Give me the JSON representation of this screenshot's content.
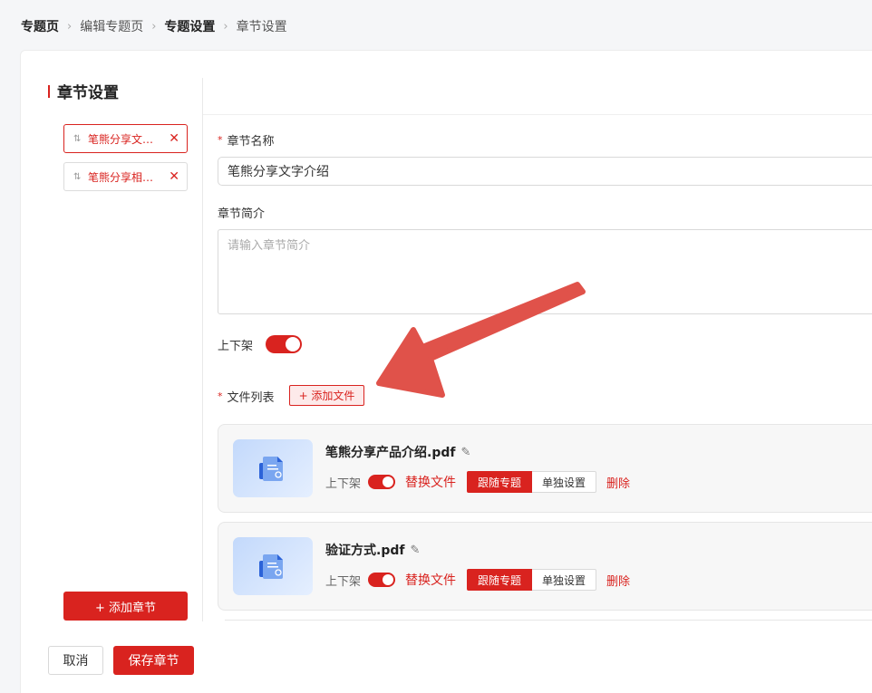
{
  "breadcrumb": [
    "专题页",
    "编辑专题页",
    "专题设置",
    "章节设置"
  ],
  "section_title": "章节设置",
  "chapters": [
    {
      "label": "笔熊分享文字介绍",
      "active": true
    },
    {
      "label": "笔熊分享相关文件",
      "active": false
    }
  ],
  "add_chapter_label": "+ 添加章节",
  "form": {
    "name_label": "章节名称",
    "name_value": "笔熊分享文字介绍",
    "intro_label": "章节简介",
    "intro_placeholder": "请输入章节简介",
    "shelf_label": "上下架",
    "shelf_on": true,
    "file_list_label": "文件列表",
    "add_file_label": "+ 添加文件"
  },
  "files": [
    {
      "name": "笔熊分享产品介绍.pdf",
      "shelf_label": "上下架",
      "shelf_on": true,
      "replace_label": "替换文件",
      "follow_label": "跟随专题",
      "separate_label": "单独设置",
      "delete_label": "删除"
    },
    {
      "name": "验证方式.pdf",
      "shelf_label": "上下架",
      "shelf_on": true,
      "replace_label": "替换文件",
      "follow_label": "跟随专题",
      "separate_label": "单独设置",
      "delete_label": "删除"
    }
  ],
  "footer": {
    "cancel_label": "取消",
    "save_label": "保存章节"
  },
  "colors": {
    "accent": "#d9231f",
    "arrow": "#e0524a"
  },
  "icons": {
    "drag": "drag-handle-icon",
    "close": "close-icon",
    "edit": "pencil-icon",
    "file": "document-icon"
  }
}
